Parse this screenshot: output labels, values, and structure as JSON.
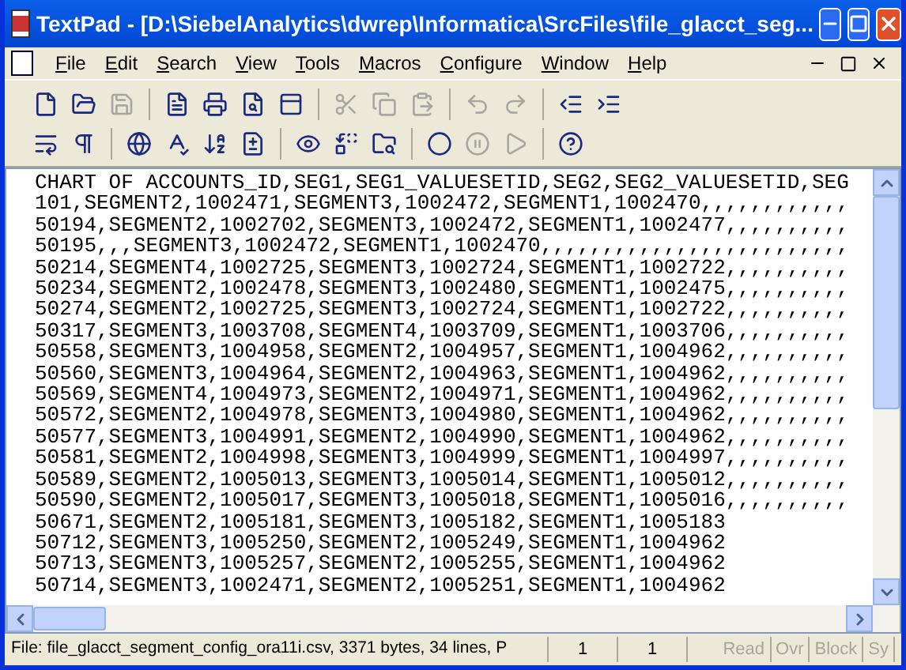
{
  "window": {
    "title": "TextPad - [D:\\SiebelAnalytics\\dwrep\\Informatica\\SrcFiles\\file_glacct_seg..."
  },
  "menu": [
    {
      "label": "File"
    },
    {
      "label": "Edit"
    },
    {
      "label": "Search"
    },
    {
      "label": "View"
    },
    {
      "label": "Tools"
    },
    {
      "label": "Macros"
    },
    {
      "label": "Configure"
    },
    {
      "label": "Window"
    },
    {
      "label": "Help"
    }
  ],
  "toolbars": [
    [
      {
        "kind": "button",
        "disabled": false
      },
      {
        "kind": "button",
        "disabled": false
      },
      {
        "kind": "button",
        "disabled": true
      },
      {
        "kind": "separator"
      },
      {
        "kind": "button",
        "disabled": false
      },
      {
        "kind": "button",
        "disabled": false
      },
      {
        "kind": "button",
        "disabled": false
      },
      {
        "kind": "button",
        "disabled": false
      },
      {
        "kind": "separator"
      },
      {
        "kind": "button",
        "disabled": true
      },
      {
        "kind": "button",
        "disabled": true
      },
      {
        "kind": "button",
        "disabled": true
      },
      {
        "kind": "separator"
      },
      {
        "kind": "button",
        "disabled": true
      },
      {
        "kind": "button",
        "disabled": true
      },
      {
        "kind": "separator"
      },
      {
        "kind": "button",
        "disabled": false
      },
      {
        "kind": "button",
        "disabled": false
      }
    ],
    [
      {
        "kind": "button",
        "disabled": false
      },
      {
        "kind": "button",
        "disabled": false
      },
      {
        "kind": "separator"
      },
      {
        "kind": "button",
        "disabled": false
      },
      {
        "kind": "button",
        "disabled": false
      },
      {
        "kind": "button",
        "disabled": false
      },
      {
        "kind": "button",
        "disabled": false
      },
      {
        "kind": "separator"
      },
      {
        "kind": "button",
        "disabled": false
      },
      {
        "kind": "button",
        "disabled": false
      },
      {
        "kind": "button",
        "disabled": false
      },
      {
        "kind": "separator"
      },
      {
        "kind": "button",
        "disabled": false
      },
      {
        "kind": "button",
        "disabled": true
      },
      {
        "kind": "button",
        "disabled": true
      },
      {
        "kind": "separator"
      },
      {
        "kind": "button",
        "disabled": false
      }
    ]
  ],
  "editor": {
    "lines": [
      "CHART OF ACCOUNTS_ID,SEG1,SEG1_VALUESETID,SEG2,SEG2_VALUESETID,SEG",
      "101,SEGMENT2,1002471,SEGMENT3,1002472,SEGMENT1,1002470,,,,,,,,,,,,",
      "50194,SEGMENT2,1002702,SEGMENT3,1002472,SEGMENT1,1002477,,,,,,,,,,",
      "50195,,,SEGMENT3,1002472,SEGMENT1,1002470,,,,,,,,,,,,,,,,,,,,,,,,,",
      "50214,SEGMENT4,1002725,SEGMENT3,1002724,SEGMENT1,1002722,,,,,,,,,,",
      "50234,SEGMENT2,1002478,SEGMENT3,1002480,SEGMENT1,1002475,,,,,,,,,,",
      "50274,SEGMENT2,1002725,SEGMENT3,1002724,SEGMENT1,1002722,,,,,,,,,,",
      "50317,SEGMENT3,1003708,SEGMENT4,1003709,SEGMENT1,1003706,,,,,,,,,,",
      "50558,SEGMENT3,1004958,SEGMENT2,1004957,SEGMENT1,1004962,,,,,,,,,,",
      "50560,SEGMENT3,1004964,SEGMENT2,1004963,SEGMENT1,1004962,,,,,,,,,,",
      "50569,SEGMENT4,1004973,SEGMENT2,1004971,SEGMENT1,1004962,,,,,,,,,,",
      "50572,SEGMENT2,1004978,SEGMENT3,1004980,SEGMENT1,1004962,,,,,,,,,,",
      "50577,SEGMENT3,1004991,SEGMENT2,1004990,SEGMENT1,1004962,,,,,,,,,,",
      "50581,SEGMENT2,1004998,SEGMENT3,1004999,SEGMENT1,1004997,,,,,,,,,,",
      "50589,SEGMENT2,1005013,SEGMENT3,1005014,SEGMENT1,1005012,,,,,,,,,,",
      "50590,SEGMENT2,1005017,SEGMENT3,1005018,SEGMENT1,1005016,,,,,,,,,,",
      "50671,SEGMENT2,1005181,SEGMENT3,1005182,SEGMENT1,1005183",
      "50712,SEGMENT3,1005250,SEGMENT2,1005249,SEGMENT1,1004962",
      "50713,SEGMENT3,1005257,SEGMENT2,1005255,SEGMENT1,1004962",
      "50714,SEGMENT3,1002471,SEGMENT2,1005251,SEGMENT1,1004962"
    ]
  },
  "status_bar": {
    "file_info": "File: file_glacct_segment_config_ora11i.csv, 3371 bytes, 34 lines, P",
    "line": "1",
    "column": "1",
    "indicators": [
      {
        "label": "Read",
        "active": false
      },
      {
        "label": "Ovr",
        "active": false
      },
      {
        "label": "Block",
        "active": false
      },
      {
        "label": "Sy",
        "active": false
      }
    ]
  }
}
